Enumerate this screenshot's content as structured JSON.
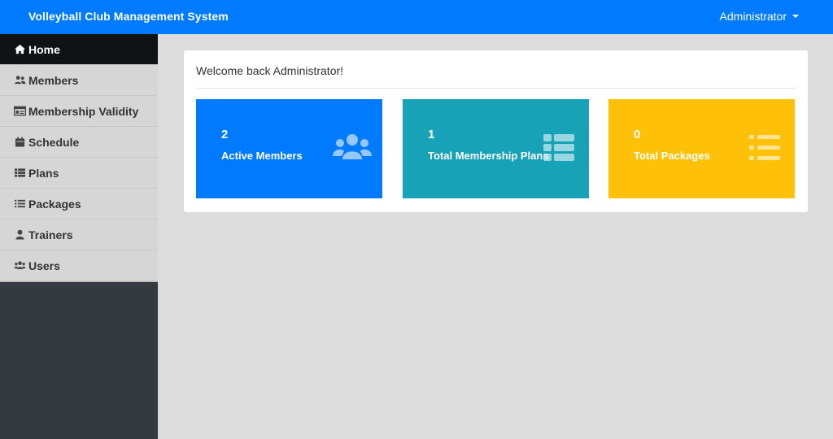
{
  "header": {
    "brand": "Volleyball Club Management System",
    "user": "Administrator"
  },
  "sidebar": {
    "items": [
      {
        "label": "Home",
        "icon": "home-icon",
        "active": true
      },
      {
        "label": "Members",
        "icon": "members-icon"
      },
      {
        "label": "Membership Validity",
        "icon": "id-card-icon"
      },
      {
        "label": "Schedule",
        "icon": "calendar-icon"
      },
      {
        "label": "Plans",
        "icon": "th-list-icon"
      },
      {
        "label": "Packages",
        "icon": "list-icon"
      },
      {
        "label": "Trainers",
        "icon": "user-icon"
      },
      {
        "label": "Users",
        "icon": "users-icon"
      }
    ]
  },
  "main": {
    "welcome": "Welcome back Administrator!",
    "stats": [
      {
        "value": "2",
        "label": "Active Members",
        "color": "#007bff",
        "icon": "users-icon"
      },
      {
        "value": "1",
        "label": "Total Membership Plans",
        "color": "#17a2b8",
        "icon": "th-list-icon"
      },
      {
        "value": "0",
        "label": "Total Packages",
        "color": "#ffc107",
        "icon": "list-icon"
      }
    ]
  },
  "colors": {
    "topbar": "#007bff",
    "sidebar_dark": "#343a40",
    "active_item": "#111214"
  }
}
